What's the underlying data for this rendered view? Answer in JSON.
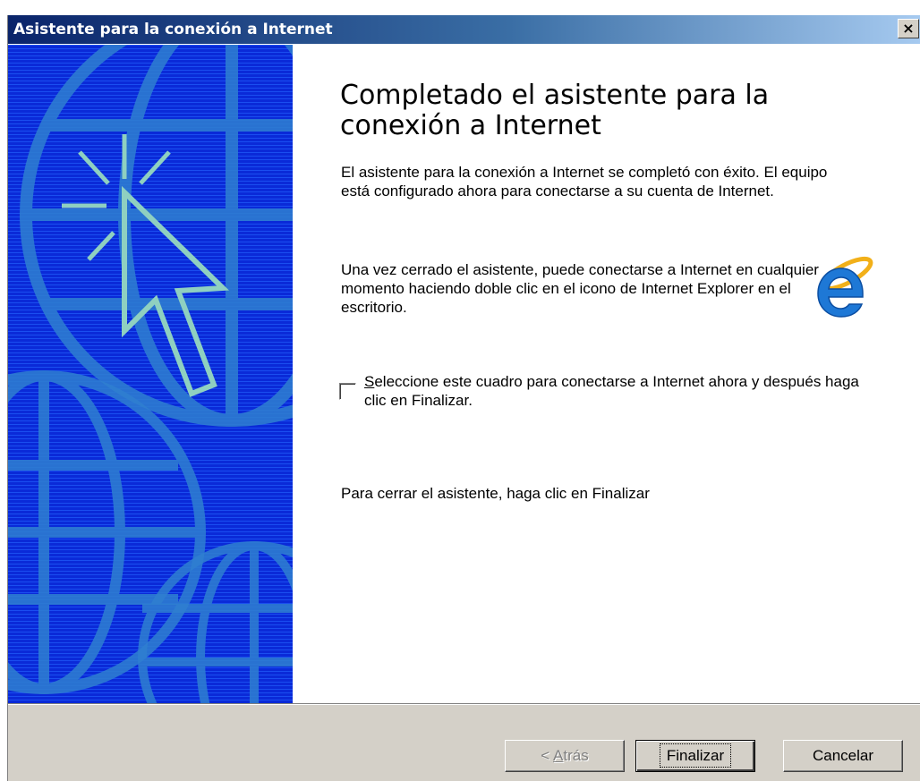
{
  "window": {
    "title": "Asistente para la conexión a Internet",
    "close_label": "×"
  },
  "content": {
    "heading": "Completado el asistente para la conexión a Internet",
    "paragraph1": "El asistente para la conexión a Internet se completó con éxito. El equipo está configurado ahora para conectarse a su cuenta de Internet.",
    "paragraph2": "Una vez cerrado el asistente, puede conectarse a Internet en cualquier momento haciendo doble clic en el icono de Internet Explorer en el escritorio.",
    "checkbox": {
      "checked": false,
      "label_accel": "S",
      "label_rest": "eleccione este cuadro para conectarse a Internet ahora y después haga clic en Finalizar."
    },
    "paragraph3": "Para cerrar el asistente, haga clic en Finalizar"
  },
  "icons": {
    "side_art": "globe-cursor-illustration",
    "browser": "internet-explorer-icon"
  },
  "buttons": {
    "back": {
      "prefix": "< ",
      "accel": "A",
      "rest": "trás",
      "disabled": true
    },
    "finish": {
      "label": "Finalizar"
    },
    "cancel": {
      "label": "Cancelar"
    }
  },
  "colors": {
    "title_bar": "#0a246a",
    "side_panel": "#0a2ad8",
    "dialog_face": "#d4d0c8"
  }
}
